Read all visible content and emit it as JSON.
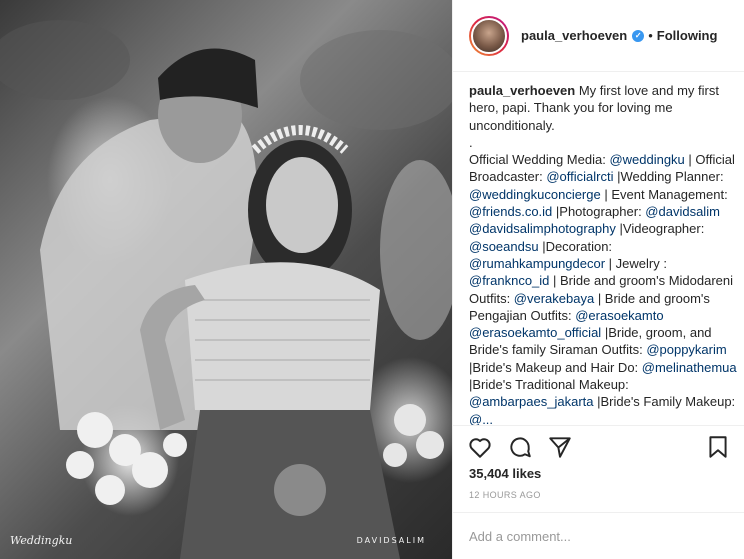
{
  "photo": {
    "watermark_left": "Weddingku",
    "watermark_right": "DAVIDSALIM"
  },
  "header": {
    "username": "paula_verhoeven",
    "separator": "•",
    "follow_status": "Following",
    "verified_icon": "check"
  },
  "caption": {
    "username": "paula_verhoeven",
    "intro": " My first love and my first hero, papi. Thank you for loving me unconditionaly.",
    "dot": ".",
    "t1": "Official Wedding Media: ",
    "m1": "@weddingku",
    "t2": " | Official Broadcaster: ",
    "m2": "@officialrcti",
    "t3": " |Wedding Planner: ",
    "m3": "@weddingkuconcierge",
    "t4": " | Event Management: ",
    "m4": "@friends.co.id",
    "t5": " |Photographer: ",
    "m5": "@davidsalim",
    "t6": " ",
    "m6": "@davidsalimphotography",
    "t7": " |Videographer: ",
    "m7": "@soeandsu",
    "t8": " |Decoration: ",
    "m8": "@rumahkampungdecor",
    "t9": " | Jewelry : ",
    "m9": "@franknco_id",
    "t10": " | Bride and groom's Midodareni Outfits: ",
    "m10": "@verakebaya",
    "t11": " | Bride and groom's Pengajian Outfits: ",
    "m11": "@erasoekamto",
    "t12": " ",
    "m12": "@erasoekamto_official",
    "t13": " |Bride, groom, and Bride's family Siraman Outfits: ",
    "m13": "@poppykarim",
    "t14": " |Bride's Makeup and Hair Do: ",
    "m14": "@melinathemua",
    "t15": " |Bride's Traditional Makeup: ",
    "m15": "@ambarpaes_jakarta",
    "t16": " |Bride's Family Makeup: ",
    "m16": "@..."
  },
  "actions": {
    "like_icon": "heart-outline",
    "comment_icon": "speech-bubble",
    "share_icon": "paper-plane",
    "save_icon": "bookmark"
  },
  "stats": {
    "likes": "35,404 likes",
    "time": "12 HOURS AGO"
  },
  "comment": {
    "placeholder": "Add a comment..."
  },
  "colors": {
    "mention": "#003569",
    "verified": "#3897f0",
    "border": "#efefef",
    "muted": "#999999"
  }
}
